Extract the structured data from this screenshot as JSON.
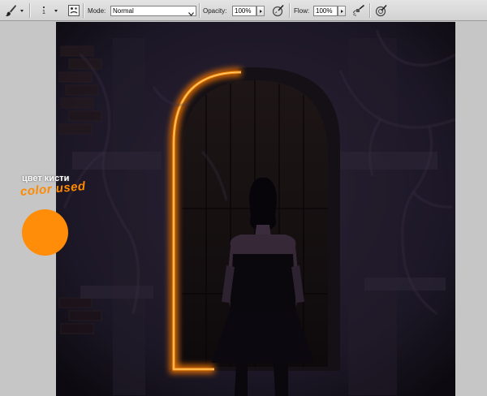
{
  "options_bar": {
    "brush_size": "1",
    "mode_label": "Mode:",
    "mode_value": "Normal",
    "opacity_label": "Opacity:",
    "opacity_value": "100%",
    "flow_label": "Flow:",
    "flow_value": "100%",
    "icons": [
      "brush-tool-icon",
      "brush-panel-icon",
      "pressure-opacity-icon",
      "airbrush-icon",
      "pressure-size-icon"
    ]
  },
  "annotation": {
    "russian_text": "цвет кисти",
    "english_text": "color used",
    "swatch_color": "#ff8d0a"
  },
  "colors": {
    "glow": "#ff8a00",
    "canvas_bg": "#16121c"
  }
}
